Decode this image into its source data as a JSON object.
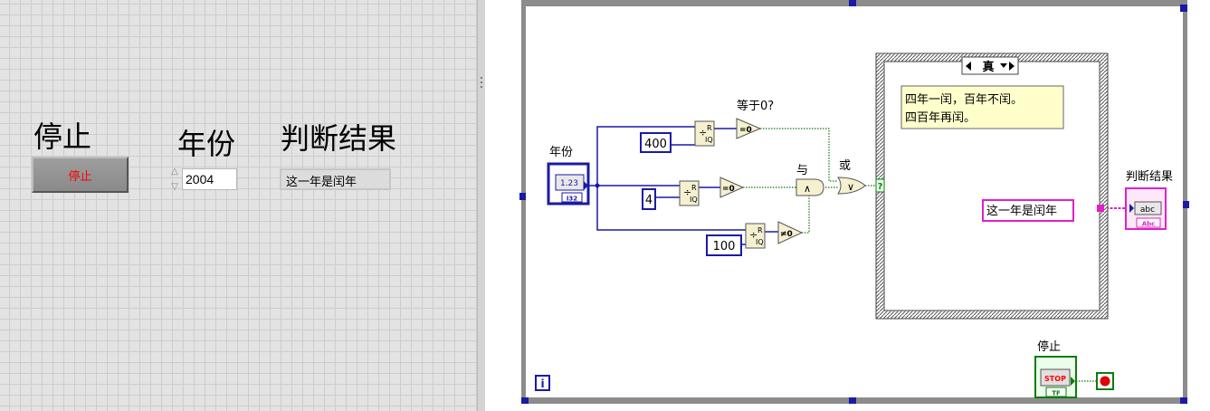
{
  "front_panel": {
    "stop_label": "停止",
    "stop_button_text": "停止",
    "year_label": "年份",
    "year_value": "2004",
    "result_label": "判断结果",
    "result_value": "这一年是闰年"
  },
  "block_diagram": {
    "year_terminal_label": "年份",
    "year_terminal_type": "1.23",
    "year_terminal_repr": "I32",
    "const_400": "400",
    "const_4": "4",
    "const_100": "100",
    "quotient_remainder_glyph": "R",
    "quotient_remainder_sub": "IQ",
    "equal_zero_label": "等于0?",
    "equal_zero_glyph": "=0",
    "not_equal_zero_glyph": "≠0",
    "and_label": "与",
    "and_glyph": "∧",
    "or_label": "或",
    "or_glyph": "∨",
    "selector_glyph": "?",
    "case_selector": "真",
    "comment_line1": "四年一闰，百年不闰。",
    "comment_line2": "四百年再闰。",
    "string_constant": "这一年是闰年",
    "result_terminal_label": "判断结果",
    "result_terminal_type": "abc",
    "result_terminal_repr": "Abc",
    "stop_terminal_label": "停止",
    "stop_terminal_text": "STOP",
    "stop_terminal_repr": "TF",
    "iteration_label": "i"
  },
  "colors": {
    "integer_wire": "#1a1aa6",
    "boolean_wire": "#0e7a0e",
    "string_wire": "#e020c8",
    "loop_border": "#8c8c8c",
    "comment_bg": "#ffffcc",
    "stop_button_text": "#ff0000"
  }
}
